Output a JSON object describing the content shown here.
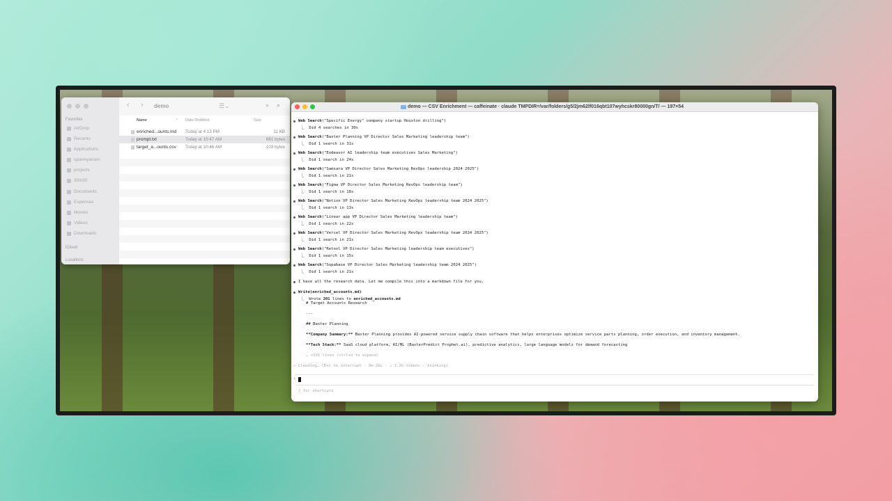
{
  "finder": {
    "title": "demo",
    "sidebar": {
      "favorites_heading": "Favorites",
      "items": [
        "AirDrop",
        "Recents",
        "Applications",
        "upaneyanam",
        "projects",
        "30in30",
        "Documents",
        "Expenses",
        "Movies",
        "Videos",
        "Downloads"
      ],
      "icloud_heading": "iCloud",
      "locations_heading": "Locations"
    },
    "columns": {
      "name": "Name",
      "date": "Date Modified",
      "size": "Size"
    },
    "files": [
      {
        "name": "enriched...ounts.md",
        "date": "Today at 4:13 PM",
        "size": "11 KB"
      },
      {
        "name": "prompt.txt",
        "date": "Today at 10:47 AM",
        "size": "681 bytes"
      },
      {
        "name": "target_a...ounts.csv",
        "date": "Today at 10:46 AM",
        "size": "103 bytes"
      }
    ]
  },
  "terminal": {
    "title": "demo — CSV Enrichment — caffeinate · claude TMPDIR=/var/folders/g5/2jm62lf016qbt107wyhcskr80000gn/T/ — 197×54",
    "searches": [
      {
        "query": "(\"Specific Energy\" company startup Houston drilling\")",
        "result": "Did 4 searches in 30s"
      },
      {
        "query": "(\"Baxter Planning VP Director Sales Marketing leadership team\")",
        "result": "Did 1 search in 31s"
      },
      {
        "query": "(\"Endeavor AI leadership team executives Sales Marketing\")",
        "result": "Did 1 search in 24s"
      },
      {
        "query": "(\"Samsara VP Director Sales Marketing RevOps leadership 2024 2025\")",
        "result": "Did 1 search in 21s"
      },
      {
        "query": "(\"Figma VP Director Sales Marketing RevOps leadership team\")",
        "result": "Did 1 search in 18s"
      },
      {
        "query": "(\"Notion VP Director Sales Marketing RevOps leadership team 2024 2025\")",
        "result": "Did 1 search in 13s"
      },
      {
        "query": "(\"Linear app VP Director Sales Marketing leadership team\")",
        "result": "Did 1 search in 22s"
      },
      {
        "query": "(\"Vercel VP Director Sales Marketing RevOps leadership team 2024 2025\")",
        "result": "Did 1 search in 21s"
      },
      {
        "query": "(\"Retool VP Director Sales Marketing leadership team executives\")",
        "result": "Did 1 search in 15s"
      },
      {
        "query": "(\"Supabase VP Director Sales Marketing leadership team 2024 2025\")",
        "result": "Did 1 search in 21s"
      }
    ],
    "tool_label": "Web Search",
    "summary_message": "I have all the research data. Let me compile this into a markdown file for you.",
    "write_call": "Write(enriched_accounts.md)",
    "write_result_prefix": "Wrote ",
    "write_result_count": "201",
    "write_result_mid": " lines to ",
    "write_result_file": "enriched_accounts.md",
    "preview": {
      "h1": "# Target Accounts Research",
      "hr": "---",
      "h2": "## Baxter Planning",
      "summary_label": "**Company Summary:**",
      "summary_text": " Baxter Planning provides AI-powered service supply chain software that helps enterprises optimize service parts planning, order execution, and inventory management.",
      "tech_label": "**Tech Stack:**",
      "tech_text": " SaaS cloud platform, AI/ML (BaxterPredict Prophet.ai), predictive analytics, large language models for demand forecasting",
      "more": "… +191 lines (ctrl+o to expand)"
    },
    "status": "✳ Clauding… (Esc to interrupt · 3m 2bs · ↓ 1.2k tokens · thinking)",
    "shortcuts_hint": "? for shortcuts"
  }
}
